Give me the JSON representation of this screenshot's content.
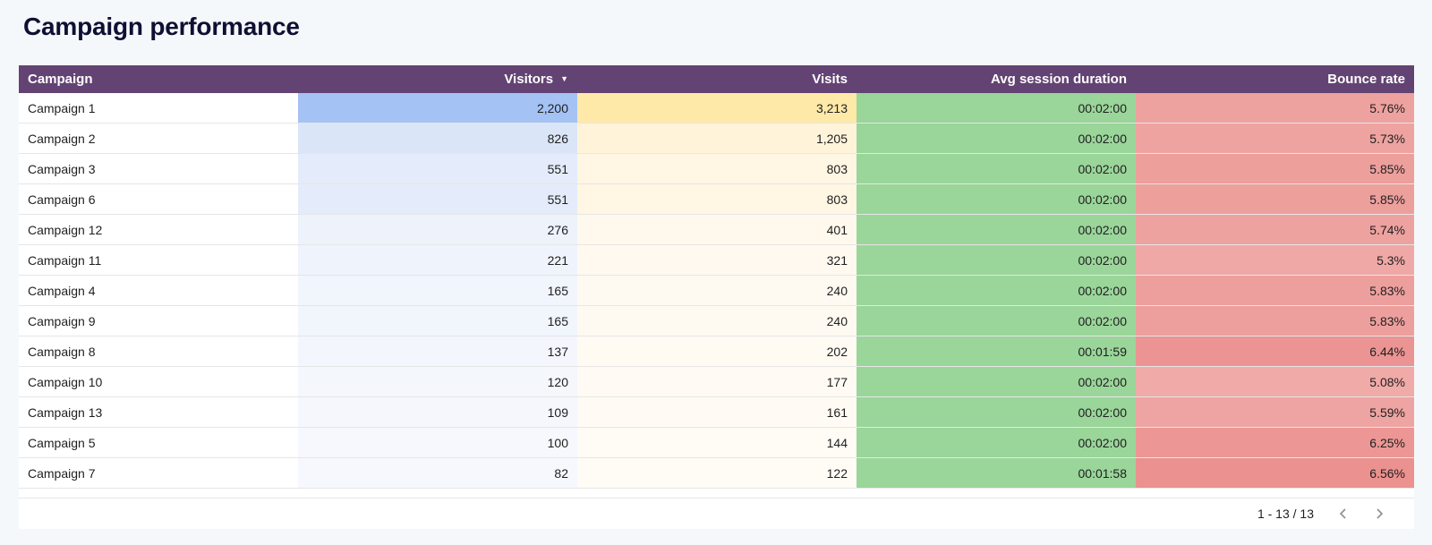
{
  "title": "Campaign performance",
  "table": {
    "headers": [
      "Campaign",
      "Visitors",
      "Visits",
      "Avg session duration",
      "Bounce rate"
    ],
    "sort_icon": "sort-down-icon",
    "rows": [
      [
        "Campaign 1",
        "2,200",
        "3,213",
        "00:02:00",
        "5.76%"
      ],
      [
        "Campaign 2",
        "826",
        "1,205",
        "00:02:00",
        "5.73%"
      ],
      [
        "Campaign 3",
        "551",
        "803",
        "00:02:00",
        "5.85%"
      ],
      [
        "Campaign 6",
        "551",
        "803",
        "00:02:00",
        "5.85%"
      ],
      [
        "Campaign 12",
        "276",
        "401",
        "00:02:00",
        "5.74%"
      ],
      [
        "Campaign 11",
        "221",
        "321",
        "00:02:00",
        "5.3%"
      ],
      [
        "Campaign 4",
        "165",
        "240",
        "00:02:00",
        "5.83%"
      ],
      [
        "Campaign 9",
        "165",
        "240",
        "00:02:00",
        "5.83%"
      ],
      [
        "Campaign 8",
        "137",
        "202",
        "00:01:59",
        "6.44%"
      ],
      [
        "Campaign 10",
        "120",
        "177",
        "00:02:00",
        "5.08%"
      ],
      [
        "Campaign 13",
        "109",
        "161",
        "00:02:00",
        "5.59%"
      ],
      [
        "Campaign 5",
        "100",
        "144",
        "00:02:00",
        "6.25%"
      ],
      [
        "Campaign 7",
        "82",
        "122",
        "00:01:58",
        "6.56%"
      ]
    ],
    "cell_colors": {
      "visitors": [
        "#a4c2f4",
        "#dae5f8",
        "#e4ecfb",
        "#e4ecfb",
        "#edf2fb",
        "#eff3fc",
        "#f1f5fc",
        "#f1f5fc",
        "#f3f6fc",
        "#f4f7fc",
        "#f5f7fd",
        "#f6f8fd",
        "#f7f8fd"
      ],
      "visits": [
        "#ffe9a9",
        "#fff4d9",
        "#fff6e3",
        "#fff6e3",
        "#fff9ed",
        "#fff9ef",
        "#fffaf1",
        "#fffaf1",
        "#fffbf3",
        "#fffbf4",
        "#fffbf4",
        "#fffbf5",
        "#fffcf6"
      ],
      "duration": [
        "#9ad59a",
        "#9ad59a",
        "#9ad59a",
        "#9ad59a",
        "#9ad59a",
        "#9ad59a",
        "#9ad59a",
        "#9ad59a",
        "#9ad59a",
        "#9ad59a",
        "#9ad59a",
        "#9ad59a",
        "#9ad59a"
      ],
      "bounce": [
        "#eea29f",
        "#eea3a0",
        "#ed9f9c",
        "#ed9f9c",
        "#eea2a0",
        "#efa8a6",
        "#ed9f9d",
        "#ed9f9d",
        "#eb9493",
        "#f0aaa8",
        "#eea4a2",
        "#ec9795",
        "#eb9190"
      ]
    }
  },
  "pagination": {
    "text": "1 - 13 / 13",
    "prev_icon": "chevron-left-icon",
    "next_icon": "chevron-right-icon"
  }
}
